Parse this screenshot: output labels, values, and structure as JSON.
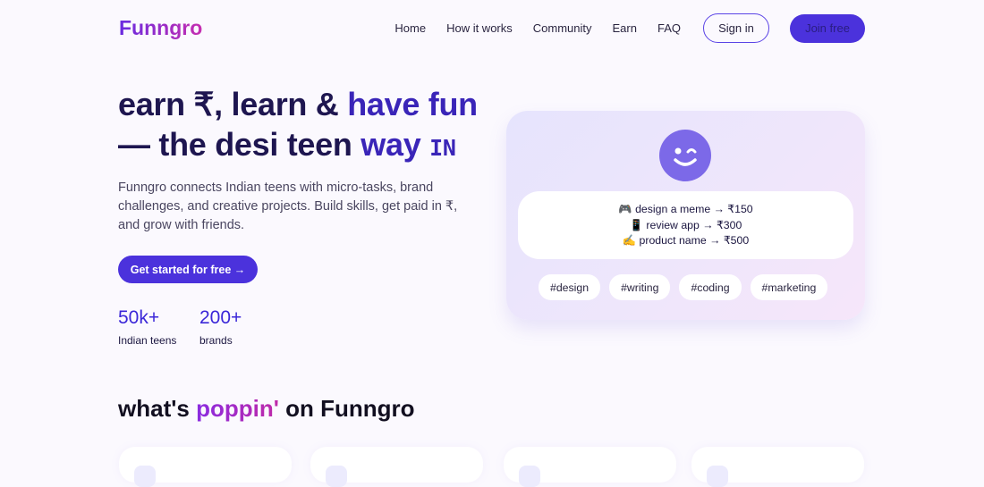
{
  "brand": "Funngro",
  "nav": {
    "items": [
      "Home",
      "How it works",
      "Community",
      "Earn",
      "FAQ"
    ],
    "sign_in": "Sign in",
    "join": "Join free"
  },
  "hero": {
    "line1a": "earn ₹, learn & ",
    "line1b": "have fun",
    "line2a": "— the desi teen ",
    "line2b": "way",
    "flag": "IN",
    "description": "Funngro connects Indian teens with micro-tasks, brand challenges, and creative projects. Build skills, get paid in ₹, and grow with friends.",
    "cta": "Get started for free →",
    "stats": [
      {
        "value": "50k+",
        "label": "Indian teens"
      },
      {
        "value": "200+",
        "label": "brands"
      }
    ]
  },
  "card": {
    "tasks": [
      "🎮 design a meme → ₹150",
      "📱 review app → ₹300",
      "✍️ product name → ₹500"
    ],
    "tags": [
      "#design",
      "#writing",
      "#coding",
      "#marketing"
    ]
  },
  "section": {
    "a": "what's ",
    "b": "poppin'",
    "c": " on Funngro"
  },
  "colors": {
    "accent": "#4b32dc",
    "dark": "#1e1650"
  }
}
